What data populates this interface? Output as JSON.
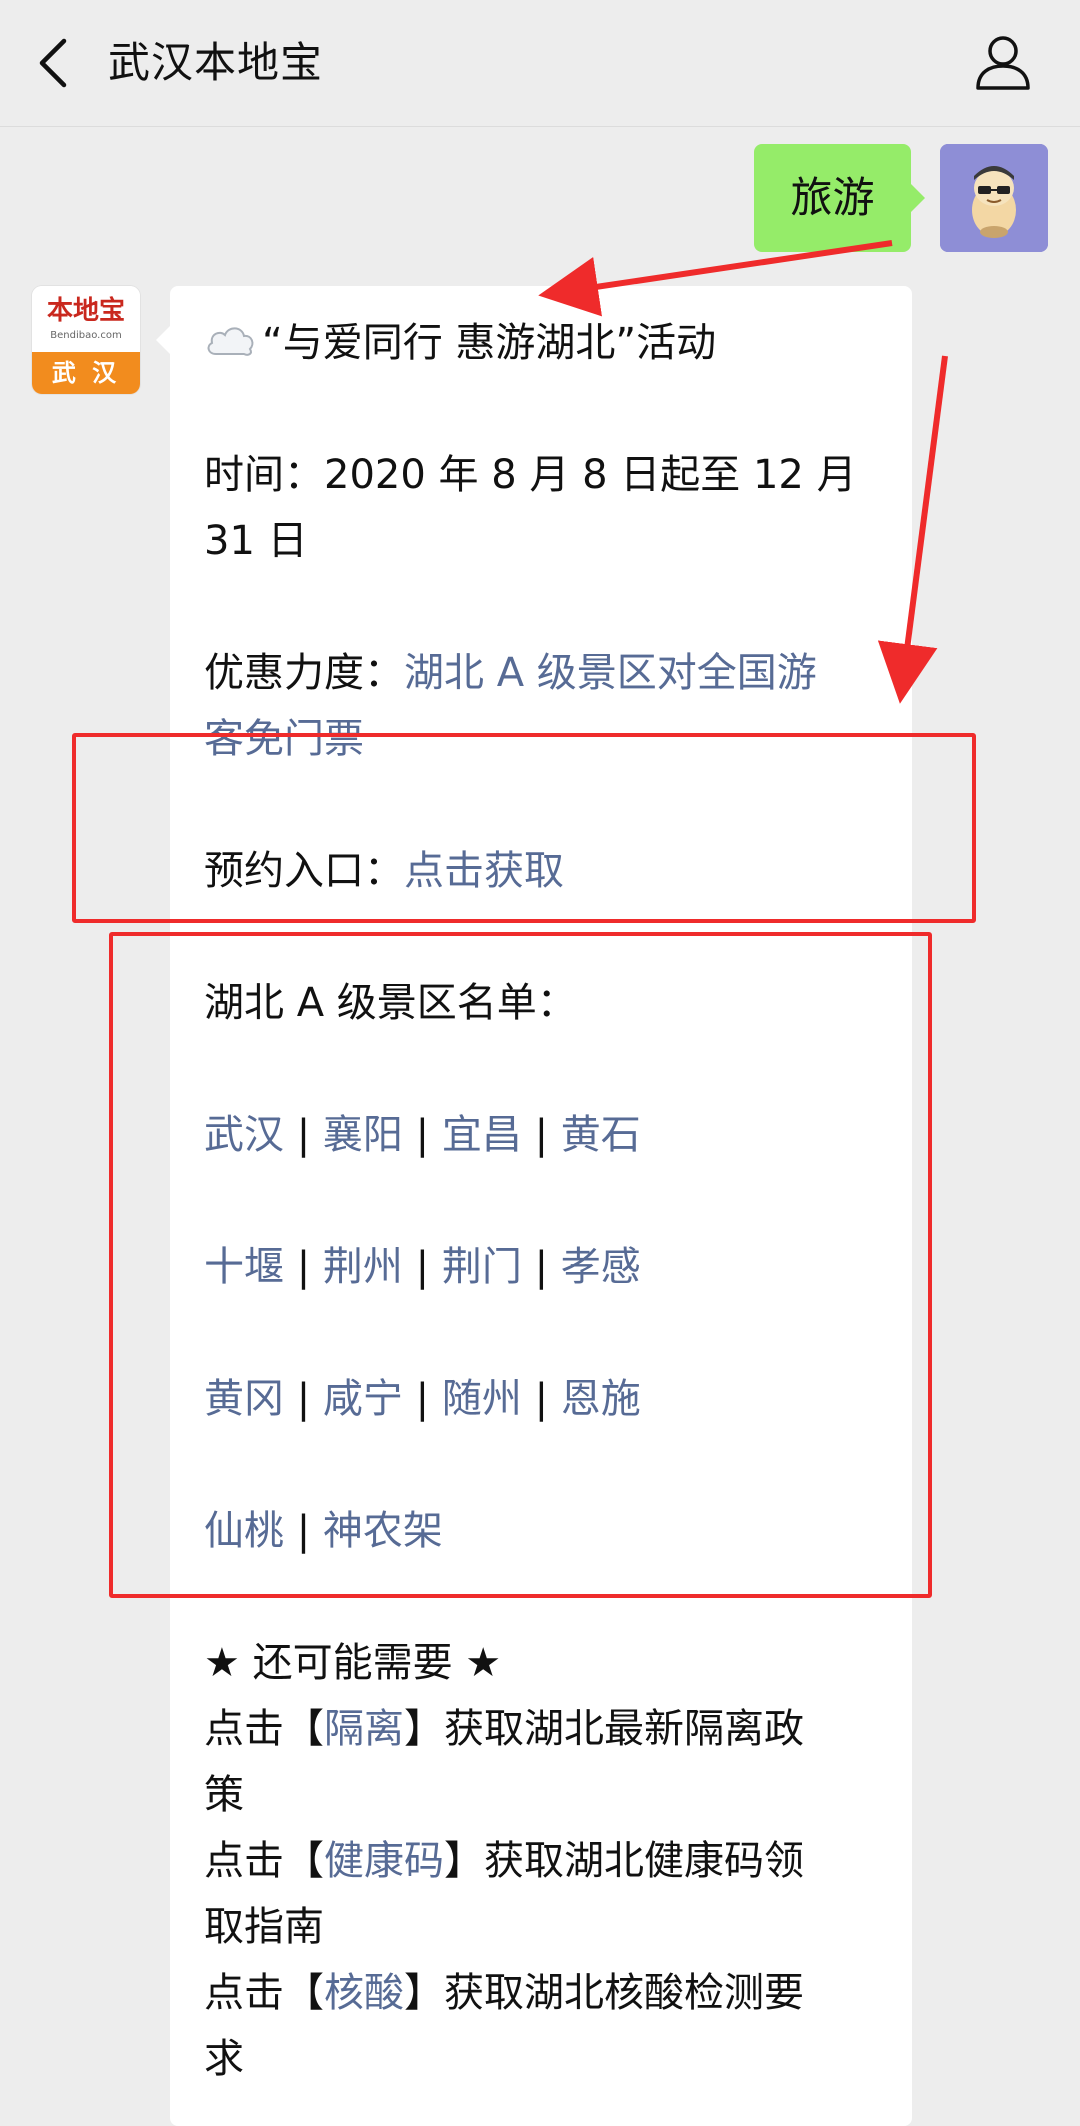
{
  "header": {
    "title": "武汉本地宝"
  },
  "chat": {
    "user_message": "旅游",
    "bot_avatar": {
      "logo_text": "本地宝",
      "logo_sub": "Bendibao.com",
      "city": "武 汉"
    },
    "message": {
      "headline": "“与爱同行 惠游湖北”活动",
      "time_label": "时间：2020 年 8 月 8 日起至 12 月",
      "time_label_cont": "31 日",
      "discount_label": "优惠力度：",
      "discount_link_1": "湖北 A 级景区对全国游",
      "discount_link_2": "客免门票",
      "booking_label": "预约入口：",
      "booking_link": "点击获取",
      "list_title": "湖北 A 级景区名单：",
      "cities": [
        [
          "武汉",
          "襄阳",
          "宜昌",
          "黄石"
        ],
        [
          "十堰",
          "荆州",
          "荆门",
          "孝感"
        ],
        [
          "黄冈",
          "咸宁",
          "随州",
          "恩施"
        ],
        [
          "仙桃",
          "神农架"
        ]
      ],
      "separator": "|",
      "extra_title": "★ 还可能需要 ★",
      "tips": [
        {
          "prefix": "点击【",
          "link": "隔离",
          "suffix_1": "】获取湖北最新隔离政",
          "suffix_2": "策"
        },
        {
          "prefix": "点击【",
          "link": "健康码",
          "suffix_1": "】获取湖北健康码领",
          "suffix_2": "取指南"
        },
        {
          "prefix": "点击【",
          "link": "核酸",
          "suffix_1": "】获取湖北核酸检测要",
          "suffix_2": "求"
        }
      ]
    }
  },
  "colors": {
    "background": "#ededed",
    "user_bubble": "#95ec69",
    "link": "#576b95",
    "annotation": "#ef2b2b"
  },
  "icons": [
    "back-chevron-icon",
    "person-profile-icon",
    "cloud-icon"
  ]
}
